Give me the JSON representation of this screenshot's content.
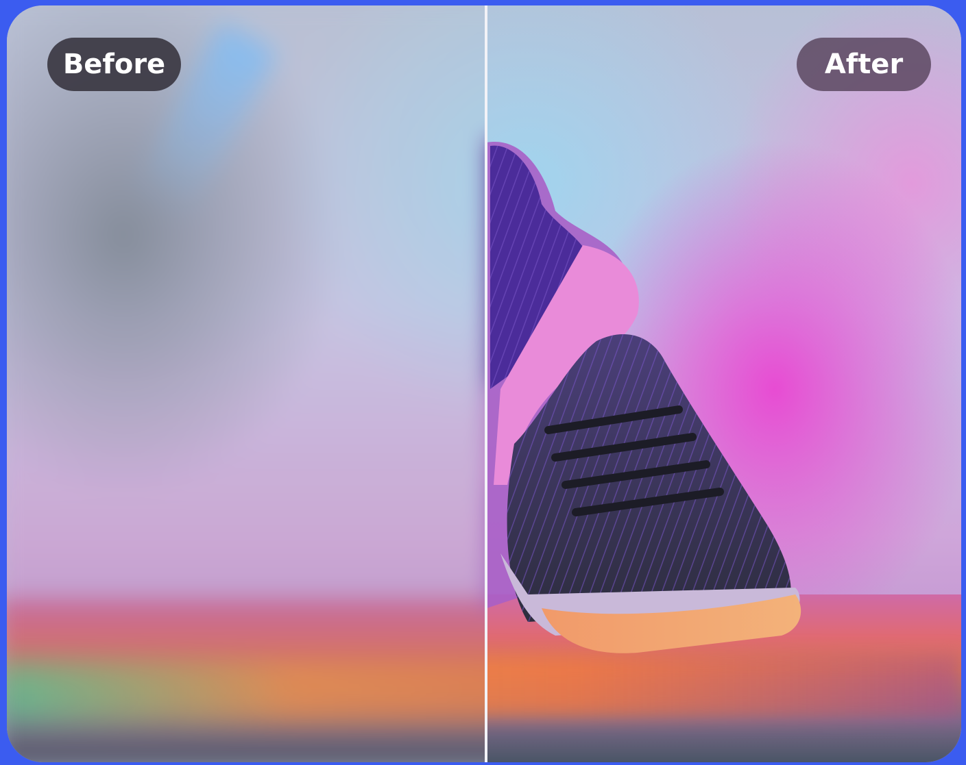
{
  "comparison": {
    "before_label": "Before",
    "after_label": "After"
  },
  "colors": {
    "frame_border": "#3b5cf0",
    "divider": "#f2f2f7",
    "before_badge": "#36323c",
    "after_badge": "#5c4860"
  },
  "image": {
    "subject": "sneaker"
  }
}
